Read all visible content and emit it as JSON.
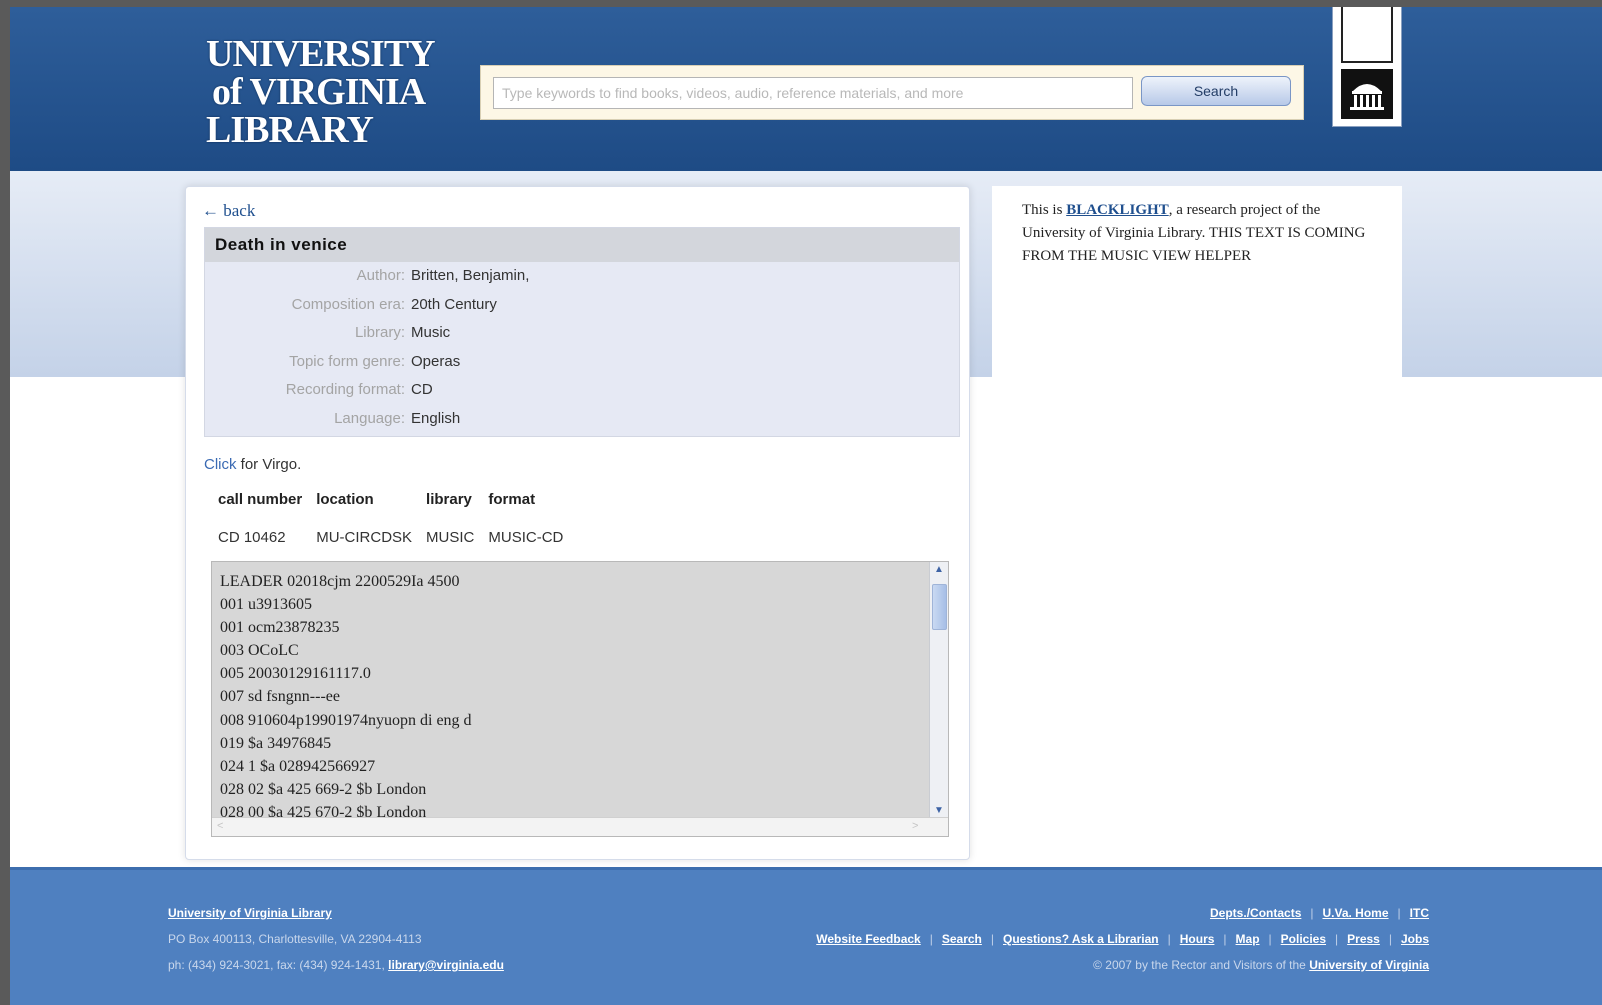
{
  "header": {
    "logo_line1": "UNIVERSITY",
    "logo_line2": "of VIRGINIA",
    "logo_line3": "LIBRARY",
    "search_placeholder": "Type keywords to find books, videos, audio, reference materials, and more",
    "search_button": "Search"
  },
  "record": {
    "back_label": "← back",
    "title": "Death in venice",
    "fields": [
      {
        "label": "Author:",
        "value": "Britten, Benjamin,"
      },
      {
        "label": "Composition era:",
        "value": "20th Century"
      },
      {
        "label": "Library:",
        "value": "Music"
      },
      {
        "label": "Topic form genre:",
        "value": "Operas"
      },
      {
        "label": "Recording format:",
        "value": "CD"
      },
      {
        "label": "Language:",
        "value": "English"
      }
    ],
    "virgo_link": "Click",
    "virgo_text": " for Virgo."
  },
  "holdings": {
    "headers": [
      "call number",
      "location",
      "library",
      "format"
    ],
    "rows": [
      [
        "CD 10462",
        "MU-CIRCDSK",
        "MUSIC",
        "MUSIC-CD"
      ]
    ]
  },
  "marc": [
    "LEADER 02018cjm 2200529Ia 4500",
    "001 u3913605",
    "001 ocm23878235",
    "003 OCoLC",
    "005 20030129161117.0",
    "007 sd fsngnn---ee",
    "008 910604p19901974nyuopn di eng d",
    "019 $a 34976845",
    "024 1 $a 028942566927",
    "028 02 $a 425 669-2 $b London",
    "028 00 $a 425 670-2 $b London"
  ],
  "sidebar": {
    "text_before": "This is ",
    "link": "BLACKLIGHT",
    "text_after": ", a research project of the University of Virginia Library. THIS TEXT IS COMING FROM THE MUSIC VIEW HELPER"
  },
  "footer": {
    "org": "University of Virginia Library",
    "address": "PO Box 400113, Charlottesville, VA 22904-4113",
    "phone": "ph: (434) 924-3021, fax: (434) 924-1431,",
    "email": "library@virginia.edu",
    "links_row1": [
      "Depts./Contacts",
      "U.Va. Home",
      "ITC"
    ],
    "links_row2": [
      "Website Feedback",
      "Search",
      "Questions? Ask a Librarian",
      "Hours",
      "Map",
      "Policies",
      "Press",
      "Jobs"
    ],
    "copyright": "© 2007 by the Rector and Visitors of the",
    "copyright_link": "University of Virginia"
  },
  "colors": {
    "header_blue": "#2e5e9a",
    "footer_blue": "#4f80c0",
    "link_blue": "#1f4f8e"
  }
}
